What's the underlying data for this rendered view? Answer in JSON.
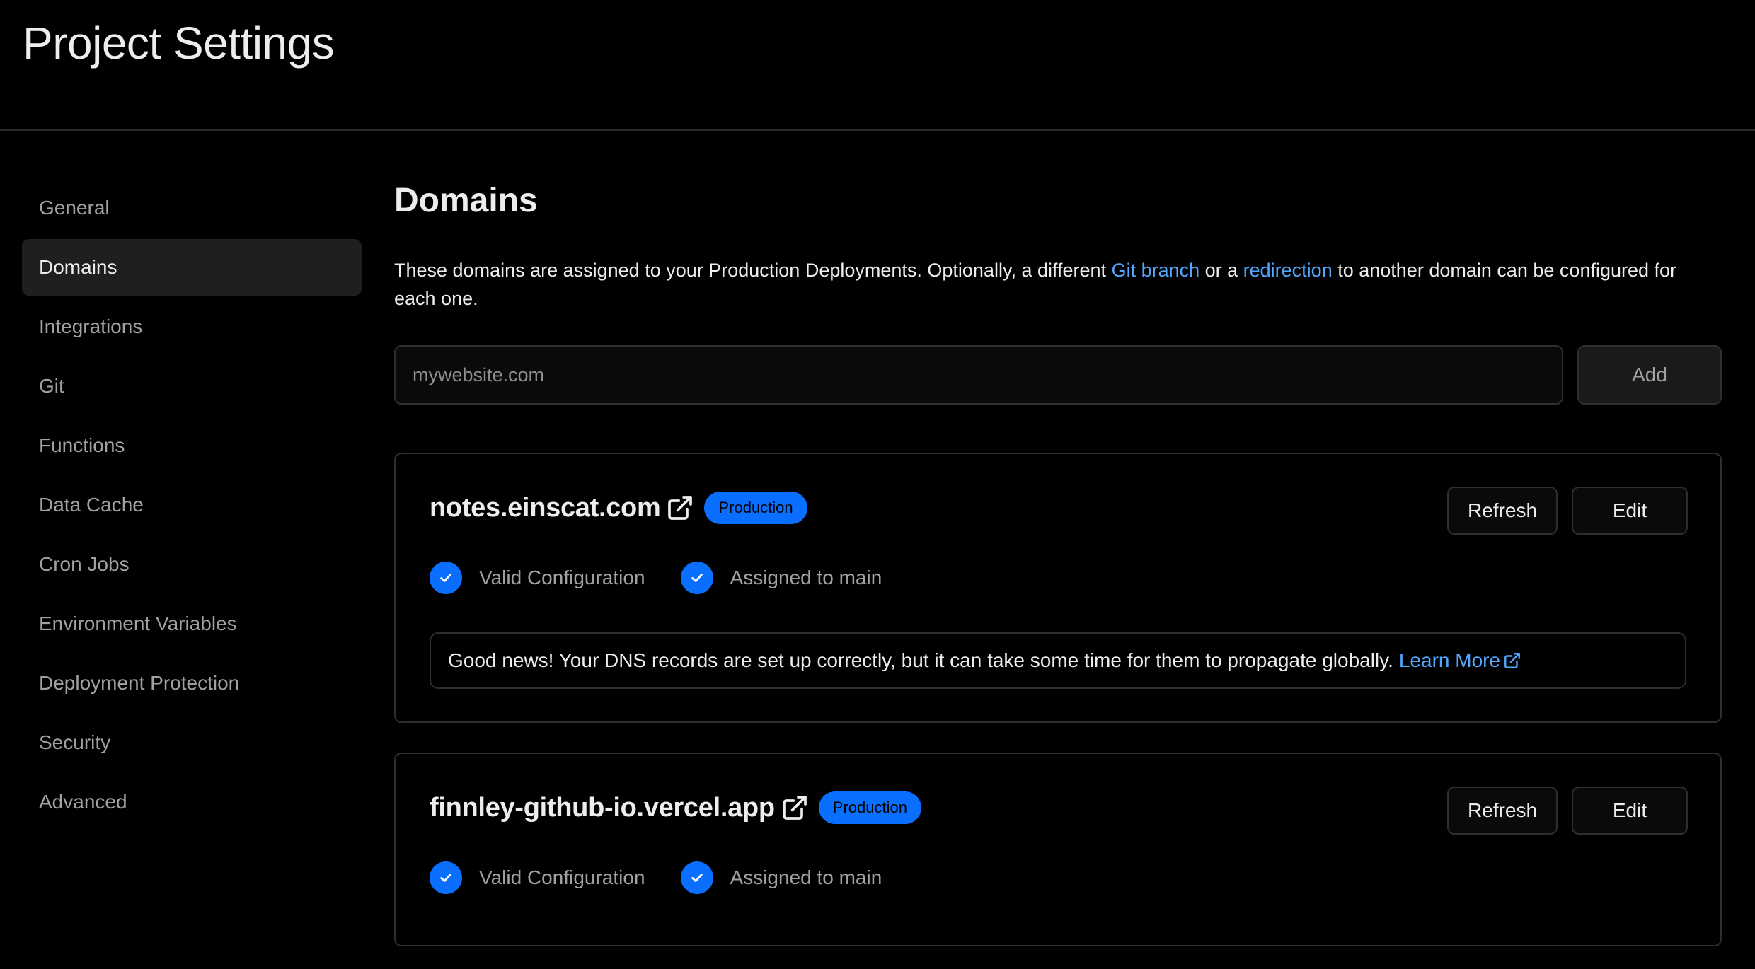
{
  "header": {
    "title": "Project Settings"
  },
  "sidebar": {
    "items": [
      {
        "label": "General",
        "active": false
      },
      {
        "label": "Domains",
        "active": true
      },
      {
        "label": "Integrations",
        "active": false
      },
      {
        "label": "Git",
        "active": false
      },
      {
        "label": "Functions",
        "active": false
      },
      {
        "label": "Data Cache",
        "active": false
      },
      {
        "label": "Cron Jobs",
        "active": false
      },
      {
        "label": "Environment Variables",
        "active": false
      },
      {
        "label": "Deployment Protection",
        "active": false
      },
      {
        "label": "Security",
        "active": false
      },
      {
        "label": "Advanced",
        "active": false
      }
    ]
  },
  "main": {
    "title": "Domains",
    "description": {
      "part1": "These domains are assigned to your Production Deployments. Optionally, a different ",
      "link1": "Git branch",
      "part2": " or a ",
      "link2": "redirection",
      "part3": " to another domain can be configured for each one."
    },
    "add_form": {
      "placeholder": "mywebsite.com",
      "value": "",
      "add_label": "Add"
    },
    "domains": [
      {
        "name": "notes.einscat.com",
        "badge": "Production",
        "refresh_label": "Refresh",
        "edit_label": "Edit",
        "status": [
          "Valid Configuration",
          "Assigned to main"
        ],
        "note": {
          "text": "Good news! Your DNS records are set up correctly, but it can take some time for them to propagate globally.",
          "link": "Learn More"
        }
      },
      {
        "name": "finnley-github-io.vercel.app",
        "badge": "Production",
        "refresh_label": "Refresh",
        "edit_label": "Edit",
        "status": [
          "Valid Configuration",
          "Assigned to main"
        ]
      }
    ]
  },
  "colors": {
    "background": "#000000",
    "accent": "#0a6fff",
    "link": "#52a8ff",
    "border": "#2e2e2e",
    "muted_text": "#a1a1a1",
    "active_nav_bg": "#1f1f1f"
  },
  "icons": {
    "external_link": "external-link-icon",
    "check": "check-circle-icon"
  }
}
